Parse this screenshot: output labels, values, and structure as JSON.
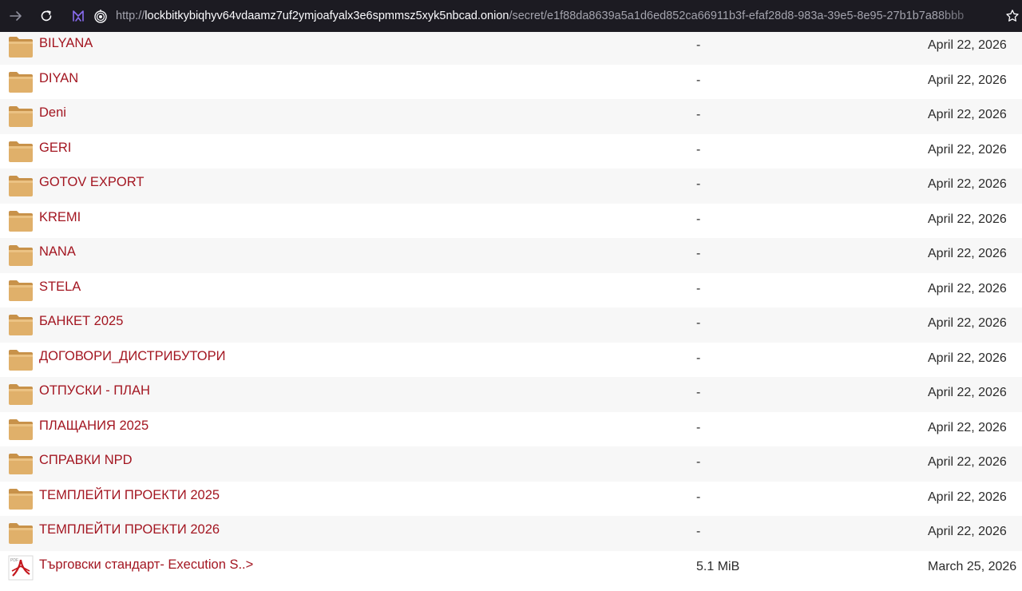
{
  "browser": {
    "url_protocol": "http://",
    "url_host": "lockbitkybiqhyv64vdaamz7uf2ymjoafyalx3e6spmmsz5xyk5nbcad.onion",
    "url_path": "/secret/e1f88da8639a5a1d6ed852ca66911b3f-efaf28d8-983a-39e5-8e95-27b1b7a88bbb"
  },
  "rows": [
    {
      "name": "BILYANA",
      "size": "-",
      "date": "April 22, 2026",
      "type": "folder"
    },
    {
      "name": "DIYAN",
      "size": "-",
      "date": "April 22, 2026",
      "type": "folder"
    },
    {
      "name": "Deni",
      "size": "-",
      "date": "April 22, 2026",
      "type": "folder"
    },
    {
      "name": "GERI",
      "size": "-",
      "date": "April 22, 2026",
      "type": "folder"
    },
    {
      "name": "GOTOV EXPORT",
      "size": "-",
      "date": "April 22, 2026",
      "type": "folder"
    },
    {
      "name": "KREMI",
      "size": "-",
      "date": "April 22, 2026",
      "type": "folder"
    },
    {
      "name": "NANA",
      "size": "-",
      "date": "April 22, 2026",
      "type": "folder"
    },
    {
      "name": "STELA",
      "size": "-",
      "date": "April 22, 2026",
      "type": "folder"
    },
    {
      "name": "БАНКЕТ 2025",
      "size": "-",
      "date": "April 22, 2026",
      "type": "folder"
    },
    {
      "name": "ДОГОВОРИ_ДИСТРИБУТОРИ",
      "size": "-",
      "date": "April 22, 2026",
      "type": "folder"
    },
    {
      "name": "ОТПУСКИ - ПЛАН",
      "size": "-",
      "date": "April 22, 2026",
      "type": "folder"
    },
    {
      "name": "ПЛАЩАНИЯ 2025",
      "size": "-",
      "date": "April 22, 2026",
      "type": "folder"
    },
    {
      "name": "СПРАВКИ NPD",
      "size": "-",
      "date": "April 22, 2026",
      "type": "folder"
    },
    {
      "name": "ТЕМПЛЕЙТИ ПРОЕКТИ 2025",
      "size": "-",
      "date": "April 22, 2026",
      "type": "folder"
    },
    {
      "name": "ТЕМПЛЕЙТИ ПРОЕКТИ 2026",
      "size": "-",
      "date": "April 22, 2026",
      "type": "folder"
    },
    {
      "name": "Търговски стандарт- Execution S..>",
      "size": "5.1 MiB",
      "date": "March 25, 2026",
      "type": "pdf"
    }
  ],
  "colors": {
    "toolbar_bg": "#1c1b22",
    "link": "#a31621",
    "folder": "#d9a85c",
    "row_alt": "#f7f7f7"
  },
  "icons": [
    "forward-arrow-icon",
    "reload-icon",
    "extension-icon",
    "tor-onion-icon",
    "bookmark-star-icon",
    "folder-icon",
    "pdf-file-icon"
  ]
}
